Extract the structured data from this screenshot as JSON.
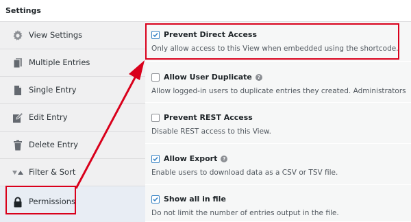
{
  "header": {
    "title": "Settings"
  },
  "sidebar": {
    "items": [
      {
        "label": "View Settings",
        "icon": "gear-icon"
      },
      {
        "label": "Multiple Entries",
        "icon": "documents-icon"
      },
      {
        "label": "Single Entry",
        "icon": "document-icon"
      },
      {
        "label": "Edit Entry",
        "icon": "edit-icon"
      },
      {
        "label": "Delete Entry",
        "icon": "trash-icon"
      },
      {
        "label": "Filter & Sort",
        "icon": "filter-sort-icon"
      },
      {
        "label": "Permissions",
        "icon": "lock-icon",
        "active": true
      }
    ]
  },
  "settings": [
    {
      "title": "Prevent Direct Access",
      "description": "Only allow access to this View when embedded using the shortcode.",
      "checked": true,
      "help": false
    },
    {
      "title": "Allow User Duplicate",
      "description": "Allow logged-in users to duplicate entries they created. Administrators",
      "checked": false,
      "help": true
    },
    {
      "title": "Prevent REST Access",
      "description": "Disable REST access to this View.",
      "checked": false,
      "help": false
    },
    {
      "title": "Allow Export",
      "description": "Enable users to download data as a CSV or TSV file.",
      "checked": true,
      "help": true
    },
    {
      "title": "Show all in file",
      "description": "Do not limit the number of entries output in the file.",
      "checked": true,
      "help": false
    }
  ],
  "colors": {
    "annotation": "#d9001b",
    "checkbox": "#3582c4",
    "active_nav": "#e8edf4"
  }
}
